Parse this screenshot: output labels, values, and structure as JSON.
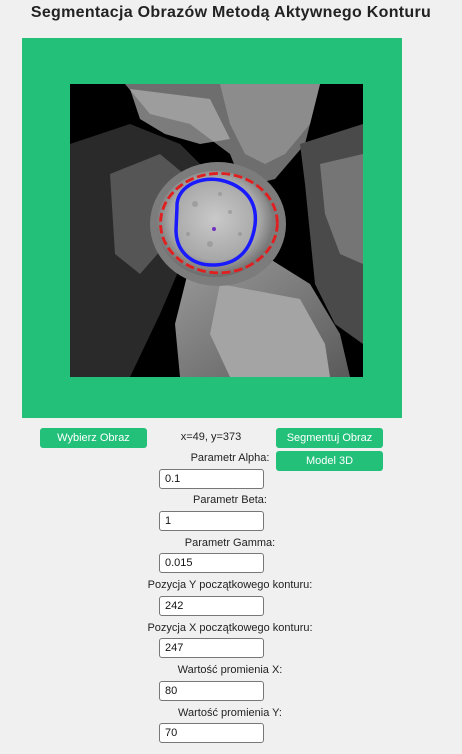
{
  "app": {
    "title": "Segmentacja Obrazów Metodą Aktywnego Konturu"
  },
  "buttons": {
    "choose_image": "Wybierz Obraz",
    "segment_image": "Segmentuj Obraz",
    "model_3d": "Model 3D"
  },
  "cursor_coords": "x=49, y=373",
  "colors": {
    "accent": "#23c07a",
    "initial_contour": "#e02020",
    "result_contour": "#1a1aff"
  },
  "image": {
    "description_icon": "knee-mri-icon"
  },
  "params": [
    {
      "label": "Parametr Alpha:",
      "value": "0.1"
    },
    {
      "label": "Parametr Beta:",
      "value": "1"
    },
    {
      "label": "Parametr Gamma:",
      "value": "0.015"
    },
    {
      "label": "Pozycja Y początkowego konturu:",
      "value": "242"
    },
    {
      "label": "Pozycja X początkowego konturu:",
      "value": "247"
    },
    {
      "label": "Wartość promienia X:",
      "value": "80"
    },
    {
      "label": "Wartość promienia Y:",
      "value": "70"
    }
  ]
}
